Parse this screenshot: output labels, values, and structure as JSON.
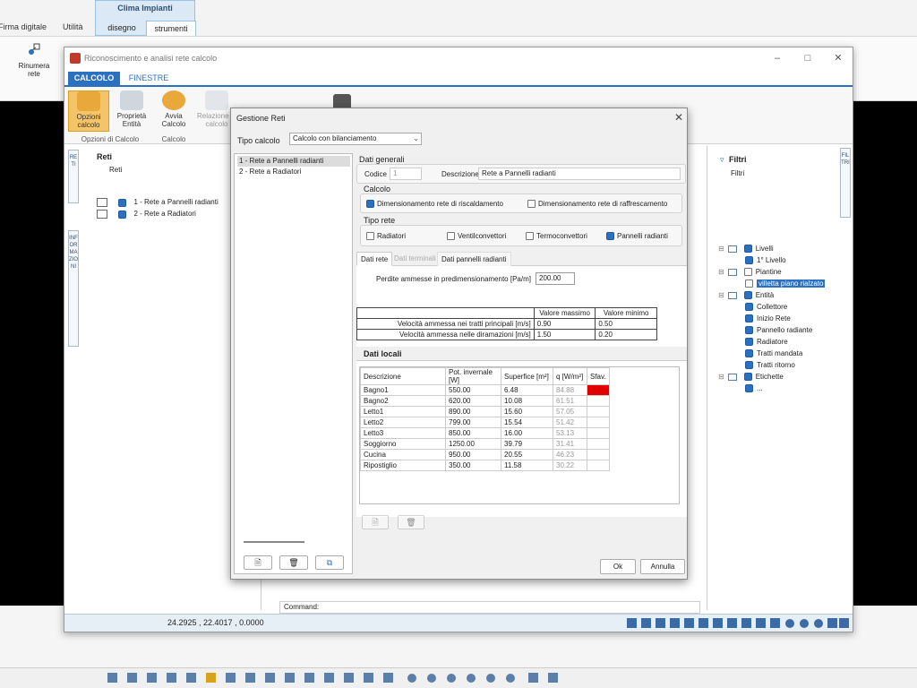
{
  "host": {
    "tabs": [
      "Firma digitale",
      "Utilità",
      "disegno",
      "strumenti"
    ],
    "group_title": "Clima Impianti",
    "left_button": "Rinumera rete"
  },
  "main": {
    "title": "Riconoscimento e analisi rete calcolo",
    "ribbon_tabs": [
      "CALCOLO",
      "FINESTRE"
    ],
    "ribbon_buttons": [
      "Opzioni calcolo",
      "Proprietà Entità",
      "Avvia Calcolo",
      "Relazione di calcolo"
    ],
    "group_labels": [
      "Opzioni di Calcolo",
      "Calcolo"
    ],
    "left_vtabs": [
      "RETI",
      "INFORMAZIONI"
    ],
    "right_vtab": "FILTRI",
    "reti": {
      "title": "Reti",
      "subtitle": "Reti",
      "items": [
        "1 - Rete a Pannelli radianti",
        "2 - Rete a Radiatori"
      ]
    },
    "filtri": {
      "title": "Filtri",
      "subtitle": "Filtri",
      "tree": [
        {
          "label": "Livelli",
          "level": 0,
          "checked": true
        },
        {
          "label": "1° Livello",
          "level": 1,
          "checked": true
        },
        {
          "label": "Piantine",
          "level": 0,
          "checked": false
        },
        {
          "label": "villetta piano rialzato",
          "level": 1,
          "checked": false,
          "selected": true
        },
        {
          "label": "Entità",
          "level": 0,
          "checked": true
        },
        {
          "label": "Collettore",
          "level": 1,
          "checked": true
        },
        {
          "label": "Inizio Rete",
          "level": 1,
          "checked": true
        },
        {
          "label": "Pannello radiante",
          "level": 1,
          "checked": true
        },
        {
          "label": "Radiatore",
          "level": 1,
          "checked": true
        },
        {
          "label": "Tratti mandata",
          "level": 1,
          "checked": true
        },
        {
          "label": "Tratti ritorno",
          "level": 1,
          "checked": true
        },
        {
          "label": "Etichette",
          "level": 0,
          "checked": true
        },
        {
          "label": "...",
          "level": 1,
          "checked": true
        }
      ]
    },
    "command_label": "Command:",
    "coords": "24.2925 , 22.4017 , 0.0000"
  },
  "dialog": {
    "title": "Gestione Reti",
    "tipo_label": "Tipo calcolo",
    "tipo_value": "Calcolo con bilanciamento",
    "list": [
      "1 - Rete a Pannelli radianti",
      "2 - Rete a Radiatori"
    ],
    "dati_generali": "Dati generali",
    "codice_label": "Codice",
    "codice_value": "1",
    "descrizione_label": "Descrizione",
    "descrizione_value": "Rete a Pannelli radianti",
    "calcolo_label": "Calcolo",
    "calcolo_opts": [
      {
        "label": "Dimensionamento rete di riscaldamento",
        "checked": true
      },
      {
        "label": "Dimensionamento rete di raffrescamento",
        "checked": false
      }
    ],
    "tipo_rete_label": "Tipo rete",
    "tipo_rete_opts": [
      {
        "label": "Radiatori",
        "checked": false
      },
      {
        "label": "Ventilconvettori",
        "checked": false
      },
      {
        "label": "Termoconvettori",
        "checked": false
      },
      {
        "label": "Pannelli radianti",
        "checked": true
      }
    ],
    "tabs": [
      "Dati rete",
      "Dati terminali",
      "Dati pannelli radianti"
    ],
    "perdite_label": "Perdite ammesse in predimensionamento [Pa/m]",
    "perdite_value": "200.00",
    "vel_headers": [
      "",
      "Valore massimo",
      "Valore minimo"
    ],
    "vel_rows": [
      [
        "Velocità ammessa nei tratti principali [m/s]",
        "0.90",
        "0.50"
      ],
      [
        "Velocità ammessa nelle diramazioni [m/s]",
        "1.50",
        "0.20"
      ]
    ],
    "dati_locali": "Dati locali",
    "loc_headers": [
      "Descrizione",
      "Pot. invernale [W]",
      "Superfice [m²]",
      "q [W/m²]",
      "Sfav."
    ],
    "loc_rows": [
      [
        "Bagno1",
        "550.00",
        "6.48",
        "84.88"
      ],
      [
        "Bagno2",
        "620.00",
        "10.08",
        "61.51"
      ],
      [
        "Letto1",
        "890.00",
        "15.60",
        "57.05"
      ],
      [
        "Letto2",
        "799.00",
        "15.54",
        "51.42"
      ],
      [
        "Letto3",
        "850.00",
        "16.00",
        "53.13"
      ],
      [
        "Soggiorno",
        "1250.00",
        "39.79",
        "31.41"
      ],
      [
        "Cucina",
        "950.00",
        "20.55",
        "46.23"
      ],
      [
        "Ripostiglio",
        "350.00",
        "11.58",
        "30.22"
      ]
    ],
    "sfav_color": "#e00000",
    "ok": "Ok",
    "annulla": "Annulla"
  },
  "colors": {
    "accent": "#2b71c0"
  }
}
